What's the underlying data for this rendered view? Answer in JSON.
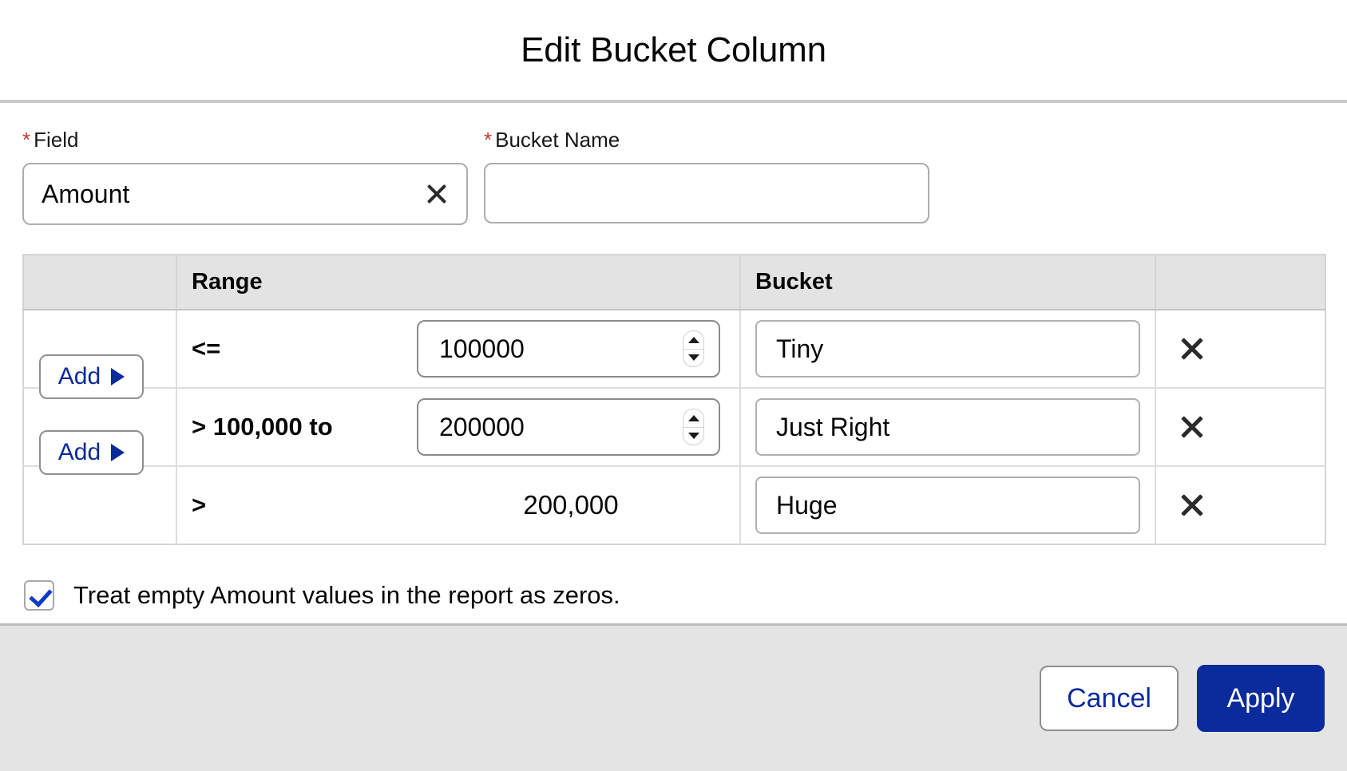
{
  "dialog": {
    "title": "Edit Bucket Column"
  },
  "form": {
    "field": {
      "label": "Field",
      "required_marker": "*",
      "value": "Amount",
      "clear_icon": "close-icon"
    },
    "bucket_name": {
      "label": "Bucket Name",
      "required_marker": "*",
      "value": "",
      "placeholder": ""
    }
  },
  "table": {
    "headers": {
      "add": "",
      "range": "Range",
      "bucket": "Bucket",
      "delete": ""
    },
    "rows": [
      {
        "operator": "<=",
        "value": "100000",
        "value_is_input": true,
        "bucket": "Tiny",
        "delete_icon": "close-icon"
      },
      {
        "operator": "> 100,000 to",
        "value": "200000",
        "value_is_input": true,
        "bucket": "Just Right",
        "delete_icon": "close-icon"
      },
      {
        "operator": ">",
        "value": "200,000",
        "value_is_input": false,
        "bucket": "Huge",
        "delete_icon": "close-icon"
      }
    ],
    "add_buttons": [
      {
        "label": "Add",
        "icon": "play-triangle-icon"
      },
      {
        "label": "Add",
        "icon": "play-triangle-icon"
      }
    ]
  },
  "options": {
    "treat_empty_as_zeros": {
      "label": "Treat empty Amount values in the report as zeros.",
      "checked": true
    }
  },
  "footer": {
    "cancel_label": "Cancel",
    "apply_label": "Apply"
  },
  "colors": {
    "accent_blue": "#0b2a9b",
    "required_red": "#c23934",
    "header_gray": "#e3e3e3",
    "footer_gray": "#e4e4e4"
  }
}
